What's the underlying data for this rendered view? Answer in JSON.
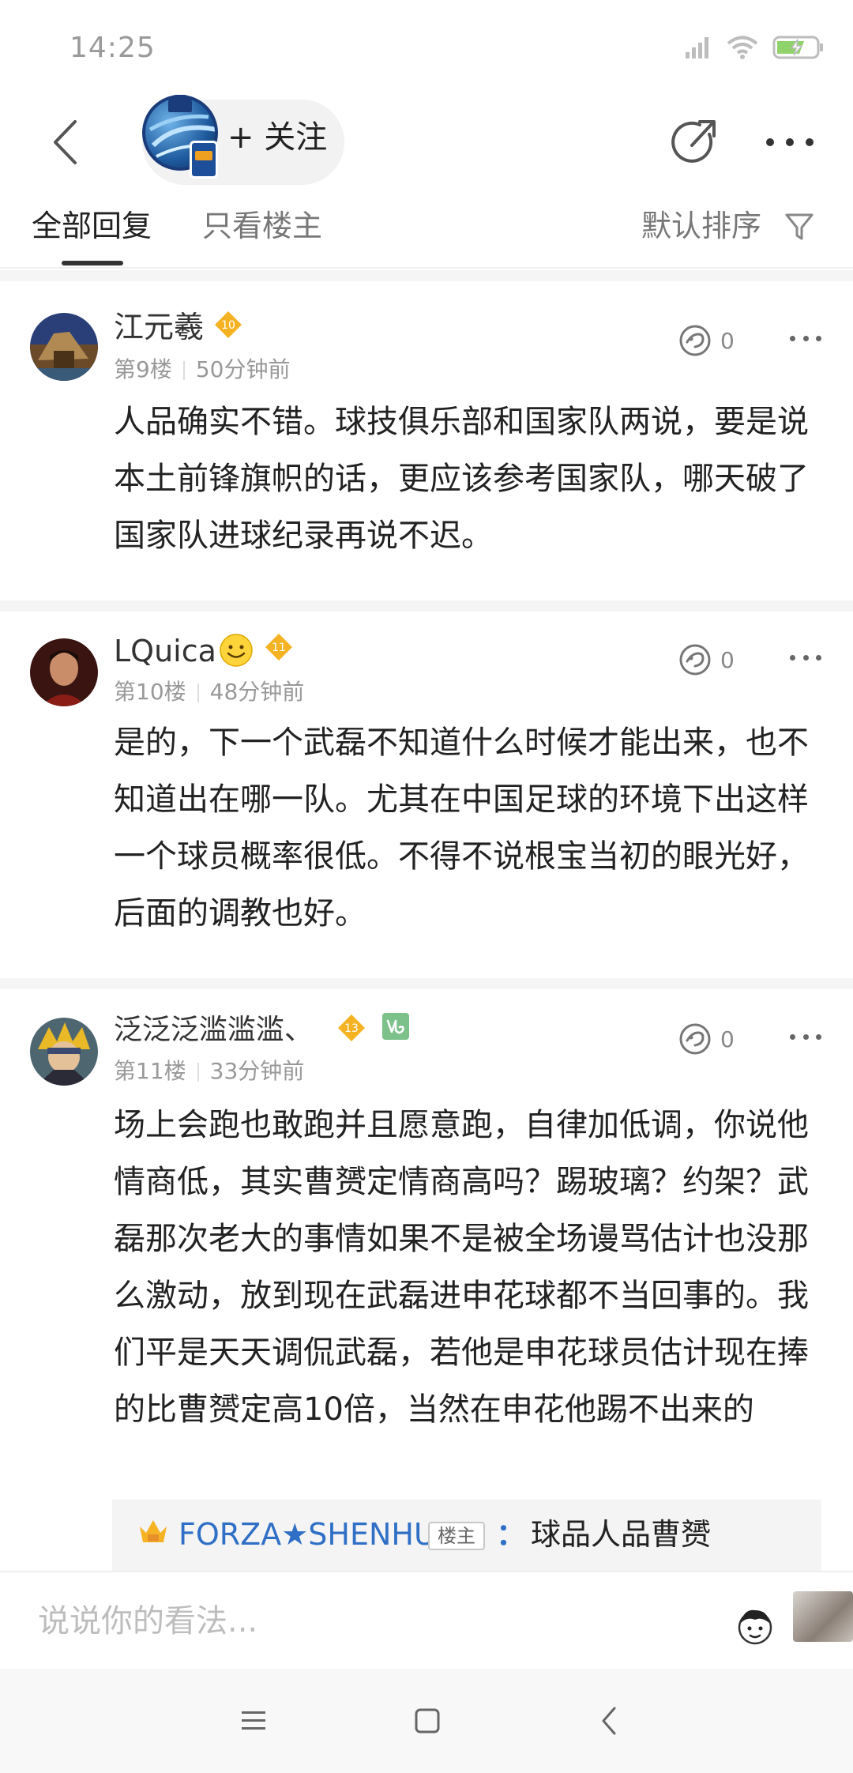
{
  "status_bar": {
    "time": "14:25"
  },
  "header": {
    "follow_label": "+ 关注"
  },
  "tabs": {
    "all": "全部回复",
    "owner_only": "只看楼主",
    "sort": "默认排序"
  },
  "comments": [
    {
      "username": "江元羲",
      "level": "10",
      "floor": "第9楼",
      "time": "50分钟前",
      "likes": "0",
      "text": "人品确实不错。球技俱乐部和国家队两说，要是说本土前锋旗帜的话，更应该参考国家队，哪天破了国家队进球纪录再说不迟。"
    },
    {
      "username": "LQuica",
      "level": "11",
      "floor": "第10楼",
      "time": "48分钟前",
      "likes": "0",
      "text": "是的，下一个武磊不知道什么时候才能出来，也不知道出在哪一队。尤其在中国足球的环境下出这样一个球员概率很低。不得不说根宝当初的眼光好，后面的调教也好。"
    },
    {
      "username": "泛泛泛滥滥滥、",
      "level": "13",
      "floor": "第11楼",
      "time": "33分钟前",
      "likes": "0",
      "text": "场上会跑也敢跑并且愿意跑，自律加低调，你说他情商低，其实曹赟定情商高吗？踢玻璃？约架？武磊那次老大的事情如果不是被全场谩骂估计也没那么激动，放到现在武磊进申花球都不当回事的。我们平是天天调侃武磊，若他是申花球员估计现在捧的比曹赟定高10倍，当然在申花他踢不出来的",
      "reply": {
        "name": "FORZA★SHENHUA",
        "tag": "楼主",
        "colon": "：",
        "text": "球品人品曹赟"
      }
    }
  ],
  "input": {
    "placeholder": "说说你的看法..."
  },
  "colors": {
    "accent_blue": "#2f6fc6",
    "badge_gold": "#f5b324"
  }
}
